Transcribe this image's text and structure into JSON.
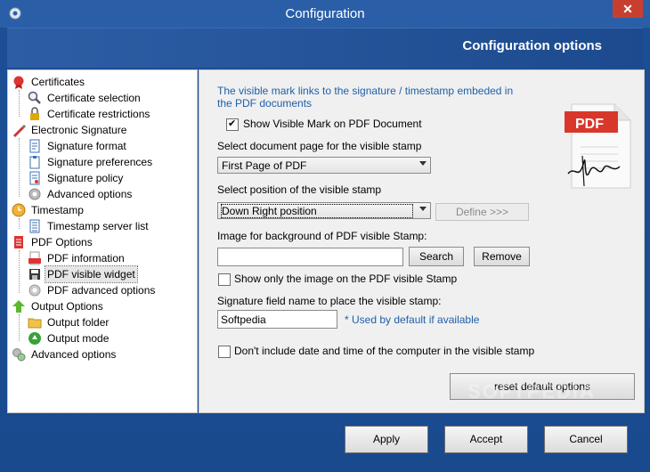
{
  "window": {
    "title": "Configuration",
    "close_label": "✕"
  },
  "header": {
    "title": "Configuration options"
  },
  "tree": [
    {
      "label": "Certificates",
      "icon": "certificate-icon",
      "color": "#c0392b"
    },
    {
      "label": "Certificate selection",
      "icon": "magnifier-icon"
    },
    {
      "label": "Certificate restrictions",
      "icon": "lock-icon"
    },
    {
      "label": "Electronic Signature",
      "icon": "pen-icon"
    },
    {
      "label": "Signature format",
      "icon": "document-icon"
    },
    {
      "label": "Signature preferences",
      "icon": "clipboard-icon"
    },
    {
      "label": "Signature policy",
      "icon": "policy-document-icon"
    },
    {
      "label": "Advanced options",
      "icon": "gear-icon"
    },
    {
      "label": "Timestamp",
      "icon": "clock-icon"
    },
    {
      "label": "Timestamp server list",
      "icon": "list-icon"
    },
    {
      "label": "PDF Options",
      "icon": "pdf-file-icon"
    },
    {
      "label": "PDF information",
      "icon": "pdf-badge-icon"
    },
    {
      "label": "PDF visible widget",
      "icon": "save-icon"
    },
    {
      "label": "PDF advanced options",
      "icon": "gear-icon"
    },
    {
      "label": "Output Options",
      "icon": "up-arrow-icon"
    },
    {
      "label": "Output folder",
      "icon": "folder-icon"
    },
    {
      "label": "Output mode",
      "icon": "green-circle-icon"
    },
    {
      "label": "Advanced options",
      "icon": "gears-icon"
    }
  ],
  "panel": {
    "info_text": "The visible mark links to the signature / timestamp embeded in the PDF documents",
    "show_mark_label": "Show Visible Mark on PDF Document",
    "show_mark_checked": true,
    "page_label": "Select document page for the visible stamp",
    "page_value": "First Page of PDF",
    "position_label": "Select position of the visible stamp",
    "position_value": "Down Right position",
    "define_label": "Define >>>",
    "image_label": "Image for background of PDF visible Stamp:",
    "image_value": "",
    "search_label": "Search",
    "remove_label": "Remove",
    "only_image_label": "Show only the image on the PDF visible Stamp",
    "only_image_checked": false,
    "field_label": "Signature field name to place the visible stamp:",
    "field_value": "Softpedia",
    "field_note": "* Used by default if available",
    "no_date_label": "Don't include date and time of the computer in the visible stamp",
    "no_date_checked": false,
    "reset_label": "reset default options",
    "pdf_badge_text": "PDF"
  },
  "buttons": {
    "apply": "Apply",
    "accept": "Accept",
    "cancel": "Cancel"
  },
  "watermark": "SOFTPEDIA"
}
